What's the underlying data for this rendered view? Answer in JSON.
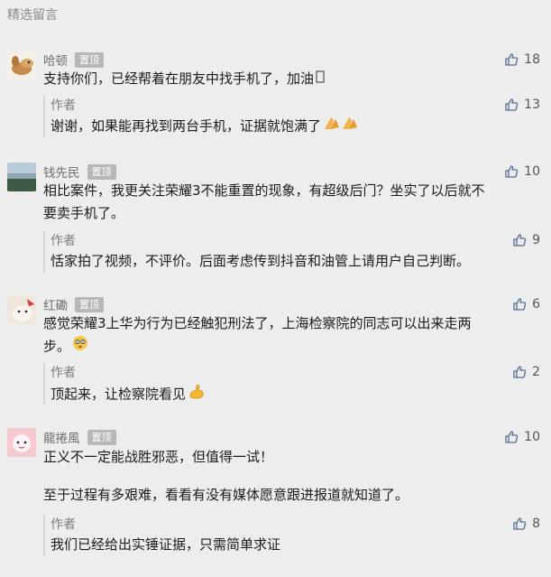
{
  "section_title": "精选留言",
  "pin_label": "置顶",
  "author_label": "作者",
  "comments": [
    {
      "name": "哈顿",
      "likes": "18",
      "text": "支持你们，已经帮着在朋友中找手机了，加油",
      "reply": {
        "likes": "13",
        "text": "谢谢，如果能再找到两台手机，证据就饱满了"
      }
    },
    {
      "name": "钱先民",
      "likes": "10",
      "text_lines": [
        "相比案件，我更关注荣耀3不能重置的现象，有超级后门？坐实了以后就不",
        "要卖手机了。"
      ],
      "reply": {
        "likes": "9",
        "text": "恬家拍了视频，不评价。后面考虑传到抖音和油管上请用户自己判断。"
      }
    },
    {
      "name": "红磡",
      "likes": "6",
      "text_lines": [
        "感觉荣耀3上华为行为已经触犯刑法了，上海检察院的同志可以出来走两",
        "步。"
      ],
      "reply": {
        "likes": "2",
        "text": "顶起来，让检察院看见"
      }
    },
    {
      "name": "龍捲風",
      "likes": "10",
      "text_lines": [
        "正义不一定能战胜邪恶，但值得一试！",
        "",
        "至于过程有多艰难，看看有没有媒体愿意跟进报道就知道了。"
      ],
      "reply": {
        "likes": "8",
        "text": "我们已经给出实锤证据，只需简单求证"
      }
    }
  ]
}
